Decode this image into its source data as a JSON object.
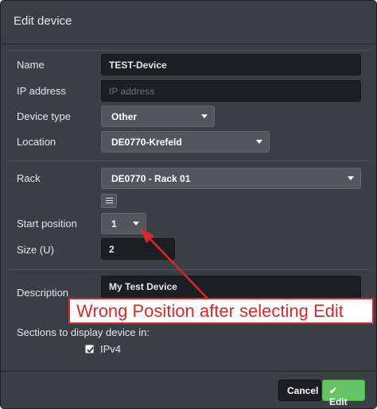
{
  "dialog": {
    "title": "Edit device"
  },
  "form": {
    "name": {
      "label": "Name",
      "value": "TEST-Device"
    },
    "ip_address": {
      "label": "IP address",
      "value": "",
      "placeholder": "IP address"
    },
    "device_type": {
      "label": "Device type",
      "selected": "Other"
    },
    "location": {
      "label": "Location",
      "selected": "DE0770-Krefeld"
    },
    "rack": {
      "label": "Rack",
      "selected": "DE0770 - Rack 01"
    },
    "start_position": {
      "label": "Start position",
      "selected": "1"
    },
    "size": {
      "label": "Size (U)",
      "value": "2"
    },
    "description": {
      "label": "Description",
      "value": "My Test Device"
    },
    "sections": {
      "label": "Sections to display device in:",
      "items": [
        {
          "label": "IPv4",
          "checked": true
        }
      ]
    }
  },
  "footer": {
    "cancel_label": "Cancel",
    "edit_label": "Edit"
  },
  "annotation": {
    "text": "Wrong Position after selecting Edit",
    "color": "#d62a2a"
  },
  "icons": [
    "list-icon",
    "caret-down-icon",
    "checkmark-icon"
  ]
}
